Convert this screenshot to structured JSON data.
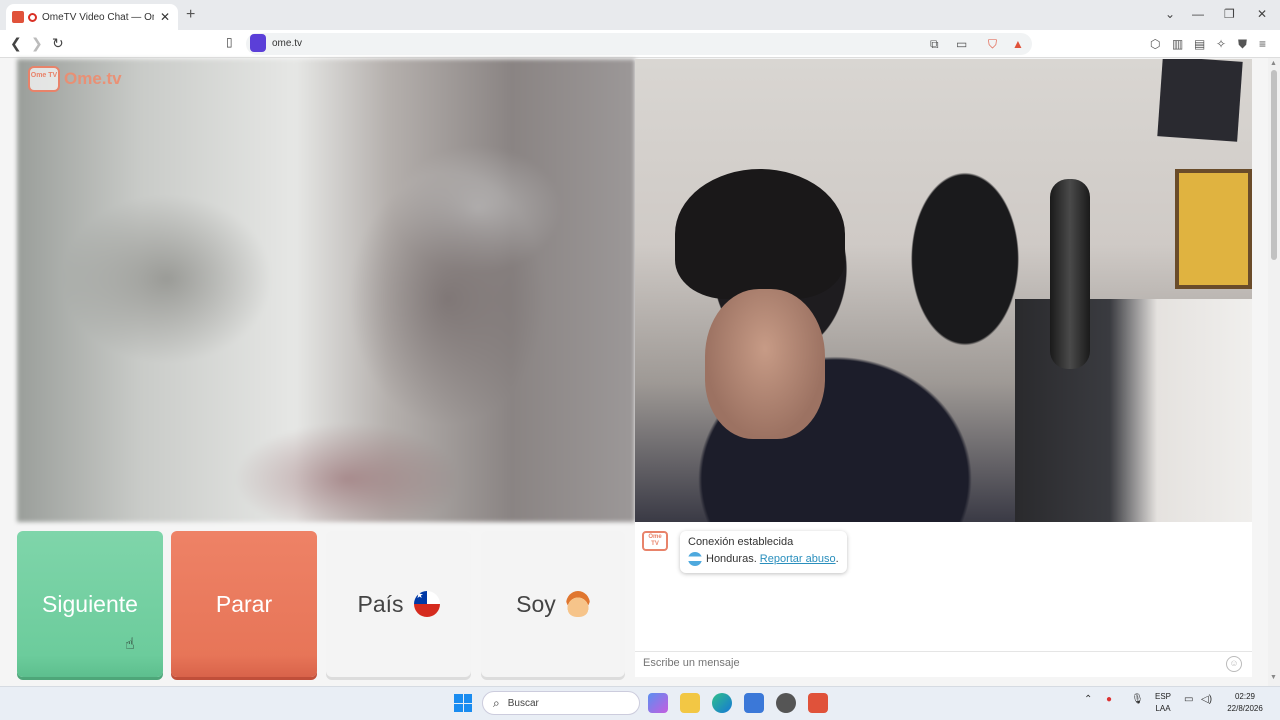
{
  "browser": {
    "tab_title": "OmeTV Video Chat — Omegl",
    "tab_close": "✕",
    "new_tab": "+",
    "url": "ome.tv",
    "window_controls": [
      "⌄",
      "—",
      "❐",
      "✕"
    ]
  },
  "page": {
    "logo_badge": "Ome TV",
    "logo_text": "Ome.tv",
    "controls": {
      "next_label": "Siguiente",
      "stop_label": "Parar",
      "country_label": "País",
      "gender_label": "Soy"
    },
    "chat": {
      "logo_badge": "Ome TV",
      "status": "Conexión establecida",
      "country": "Honduras.",
      "report_link": "Reportar abuso",
      "report_suffix": ".",
      "input_placeholder": "Escribe un mensaje"
    }
  },
  "taskbar": {
    "search_placeholder": "Buscar",
    "lang_top": "ESP",
    "lang_bottom": "LAA",
    "time": "02:29",
    "date": "22/8/2026"
  },
  "icons": [
    "back-icon",
    "forward-icon",
    "reload-icon",
    "bookmark-icon",
    "translate-icon",
    "cast-icon",
    "brave-shield-icon",
    "brave-rewards-icon",
    "extensions-icon",
    "sidebar-icon",
    "wallet-icon",
    "leo-icon",
    "vpn-icon",
    "menu-icon",
    "windows-icon",
    "search-icon",
    "edge-icon",
    "explorer-icon",
    "store-icon",
    "brave-icon"
  ]
}
